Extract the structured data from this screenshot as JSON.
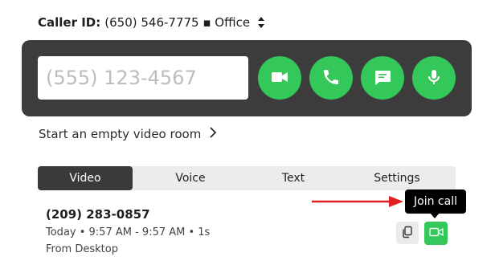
{
  "caller_id": {
    "label": "Caller ID:",
    "value": "(650) 546-7775 ▪ Office"
  },
  "dialer": {
    "placeholder": "(555) 123-4567",
    "buttons": [
      {
        "icon": "video-camera-icon",
        "action": "video"
      },
      {
        "icon": "phone-icon",
        "action": "voice"
      },
      {
        "icon": "message-icon",
        "action": "text"
      },
      {
        "icon": "microphone-icon",
        "action": "mic"
      }
    ]
  },
  "empty_room": {
    "label": "Start an empty video room"
  },
  "tabs": [
    {
      "label": "Video",
      "active": true
    },
    {
      "label": "Voice",
      "active": false
    },
    {
      "label": "Text",
      "active": false
    },
    {
      "label": "Settings",
      "active": false
    }
  ],
  "call": {
    "number": "(209) 283-0857",
    "meta": "Today • 9:57 AM - 9:57 AM • 1s",
    "source": "From Desktop"
  },
  "tooltip": {
    "text": "Join call"
  },
  "colors": {
    "green": "#34c75a",
    "dark_panel": "#3c3c3c",
    "annotation_red": "#e02020"
  }
}
